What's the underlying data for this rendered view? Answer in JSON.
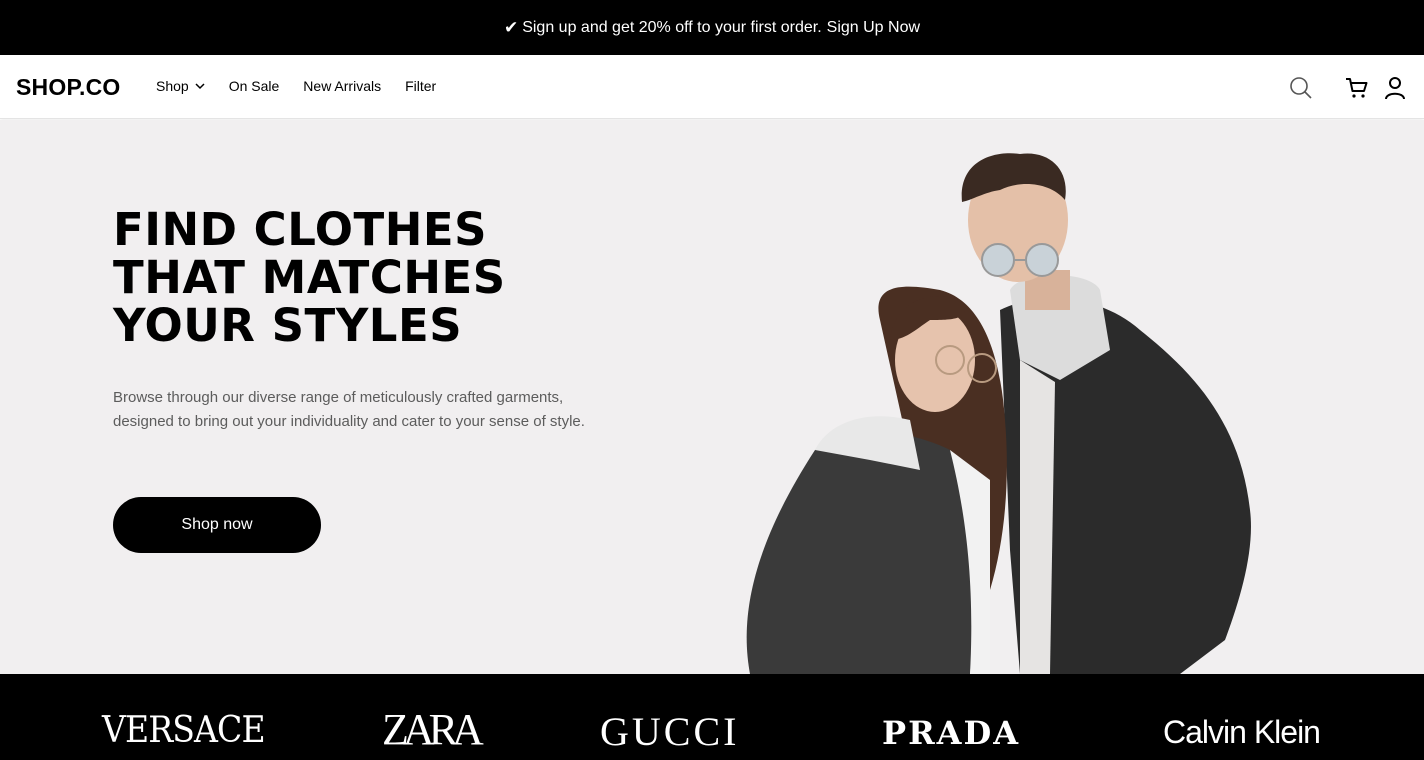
{
  "announcement": {
    "text": "Sign up and get 20% off to your first order.",
    "link": "Sign Up Now"
  },
  "nav": {
    "logo": "SHOP.CO",
    "menu": [
      {
        "label": "Shop"
      },
      {
        "label": "On Sale"
      },
      {
        "label": "New Arrivals"
      },
      {
        "label": "Filter"
      }
    ],
    "icons": [
      "search-icon",
      "cart-icon",
      "user-icon"
    ]
  },
  "hero": {
    "title_line1": "FIND CLOTHES",
    "title_line2": "THAT MATCHES",
    "title_line3": "YOUR STYLES",
    "description": "Browse through our diverse range of meticulously crafted garments, designed to bring out your individuality and cater to your sense of style.",
    "cta": "Shop now"
  },
  "brands": [
    "VERSACE",
    "ZARA",
    "GUCCI",
    "PRADA",
    "Calvin Klein"
  ],
  "colors": {
    "announcement_bg": "#000000",
    "hero_bg": "#f1eff0",
    "brand_bar_bg": "#000000",
    "cta_bg": "#000000"
  }
}
